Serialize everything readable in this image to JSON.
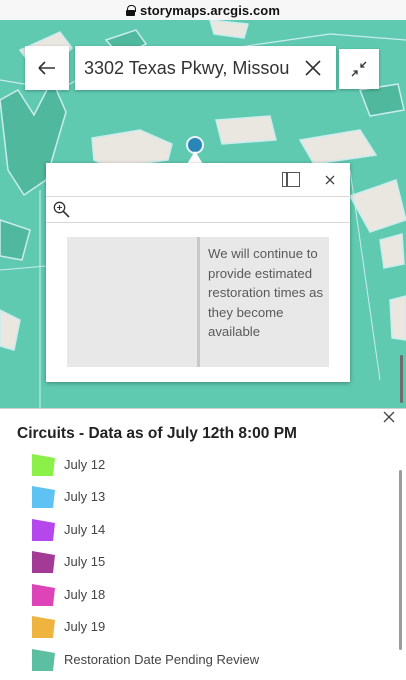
{
  "browser": {
    "url": "storymaps.arcgis.com"
  },
  "search": {
    "value": "3302 Texas Pkwy, Missou"
  },
  "map": {
    "colors": {
      "land": "#5fcab0",
      "water_highlight": "#c9ecef",
      "streets": "#e9e7df",
      "marker": "#2a86b8"
    }
  },
  "popup": {
    "message": "We will continue to provide estimated restoration times as they become available",
    "icons": [
      "dock-icon",
      "close-icon",
      "zoom-to-icon"
    ]
  },
  "legend": {
    "title": "Circuits - Data as of July 12th 8:00 PM",
    "items": [
      {
        "label": "July 12",
        "color": "#8bf048"
      },
      {
        "label": "July 13",
        "color": "#5ec3f2"
      },
      {
        "label": "July 14",
        "color": "#b548ec"
      },
      {
        "label": "July 15",
        "color": "#a23a96"
      },
      {
        "label": "July 18",
        "color": "#dd44b8"
      },
      {
        "label": "July 19",
        "color": "#efb33f"
      },
      {
        "label": "Restoration Date Pending Review",
        "color": "#5cbfa1"
      }
    ]
  }
}
